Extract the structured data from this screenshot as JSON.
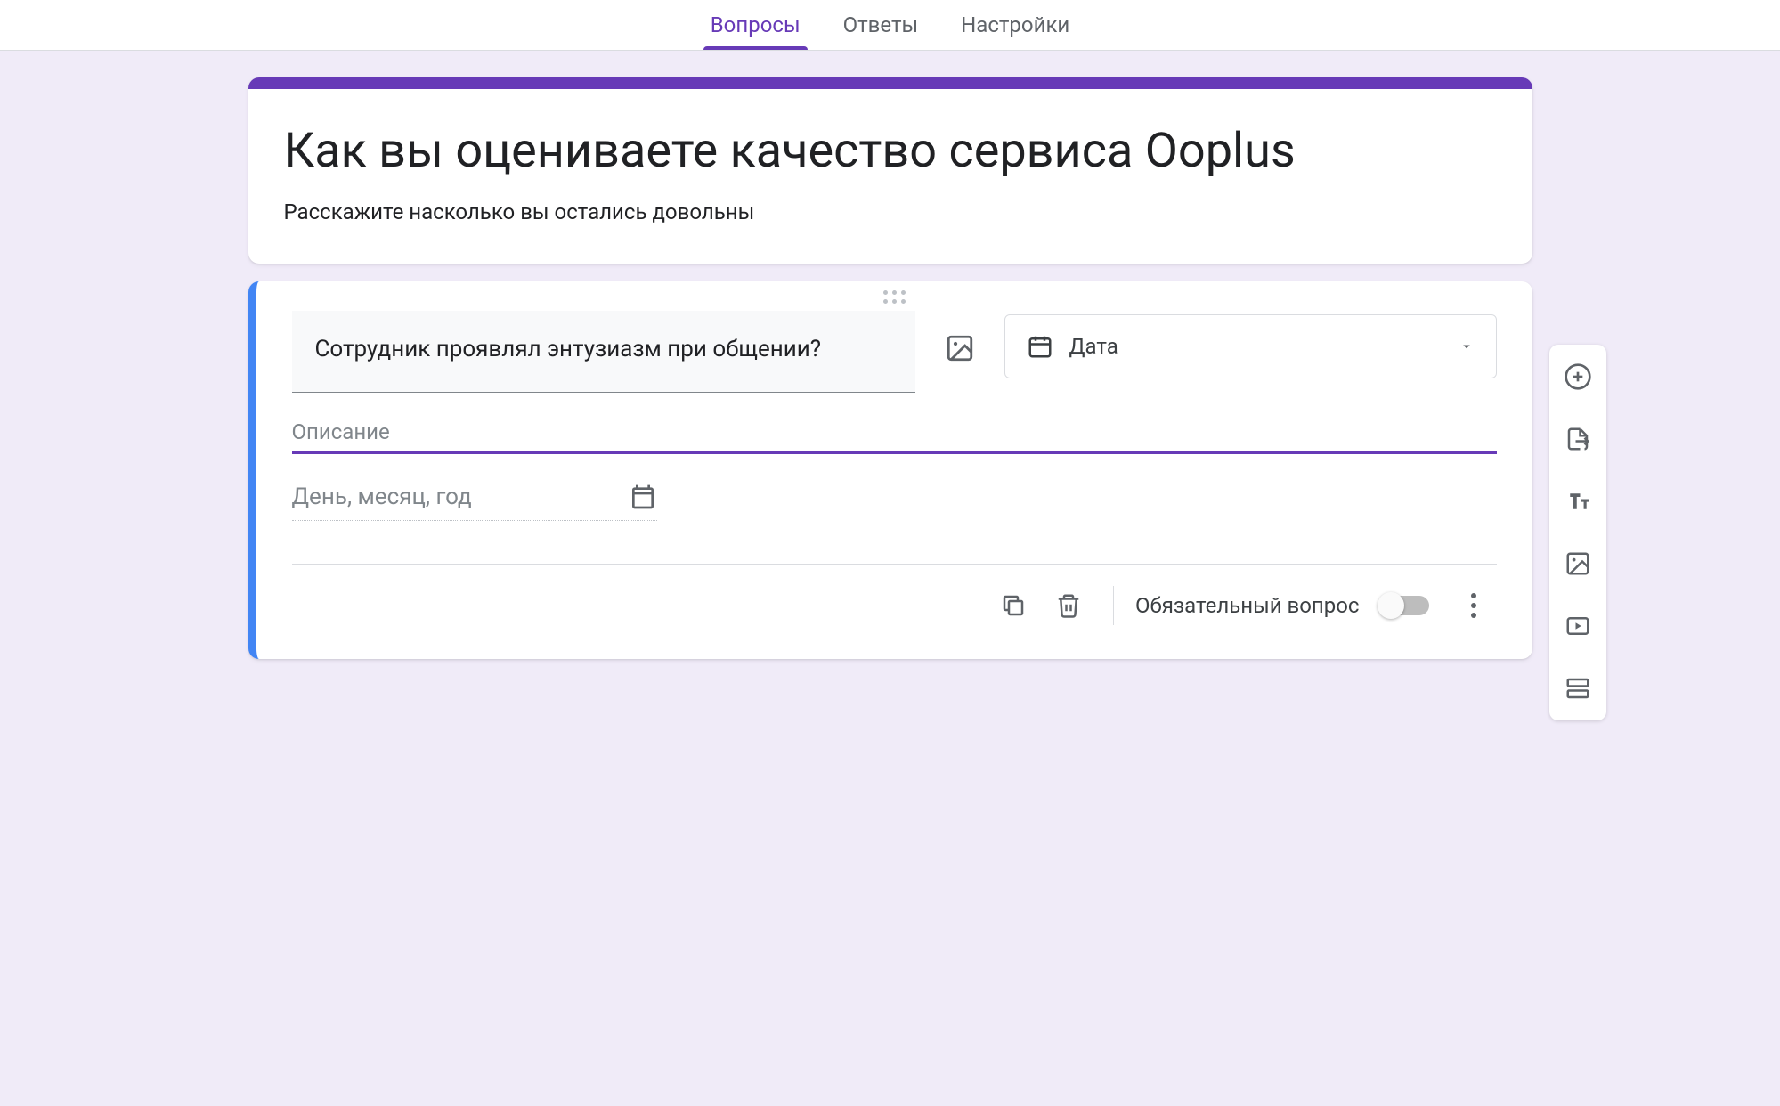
{
  "tabs": {
    "questions": "Вопросы",
    "responses": "Ответы",
    "settings": "Настройки"
  },
  "form": {
    "title": "Как вы оцениваете качество сервиса Ooplus",
    "description": "Расскажите насколько вы остались довольны"
  },
  "question": {
    "text": "Сотрудник проявлял энтузиазм при общении?",
    "type_label": "Дата",
    "desc_placeholder": "Описание",
    "desc_value": "",
    "date_preview": "День, месяц, год"
  },
  "footer": {
    "required_label": "Обязательный вопрос",
    "required": false
  },
  "side_toolbar_items": [
    "add-question",
    "import-questions",
    "add-title",
    "add-image",
    "add-video",
    "add-section"
  ]
}
